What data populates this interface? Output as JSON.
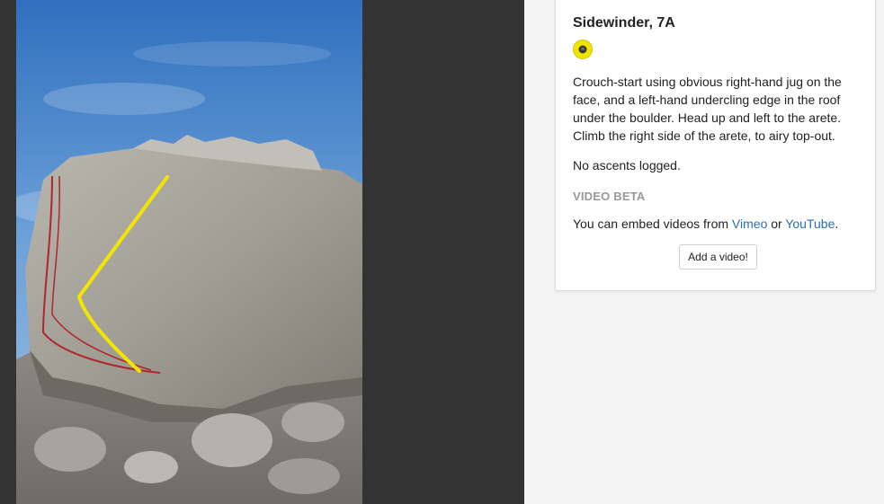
{
  "problem": {
    "title": "Sidewinder, 7A",
    "grade_color": "#f1e400",
    "grade_icon": "circle-icon",
    "description": "Crouch-start using obvious right-hand jug on the face, and a left-hand undercling edge in the roof under the boulder. Head up and left to the arete. Climb the right side of the arete, to airy top-out.",
    "ascents": "No ascents logged."
  },
  "video": {
    "heading": "VIDEO BETA",
    "embed_prefix": "You can embed videos from ",
    "vimeo_label": "Vimeo",
    "or_text": " or ",
    "youtube_label": "YouTube",
    "embed_suffix": ".",
    "add_button": "Add a video!"
  },
  "photo": {
    "line_highlight_color": "#f2e600",
    "line_other_color": "#b0262a"
  }
}
